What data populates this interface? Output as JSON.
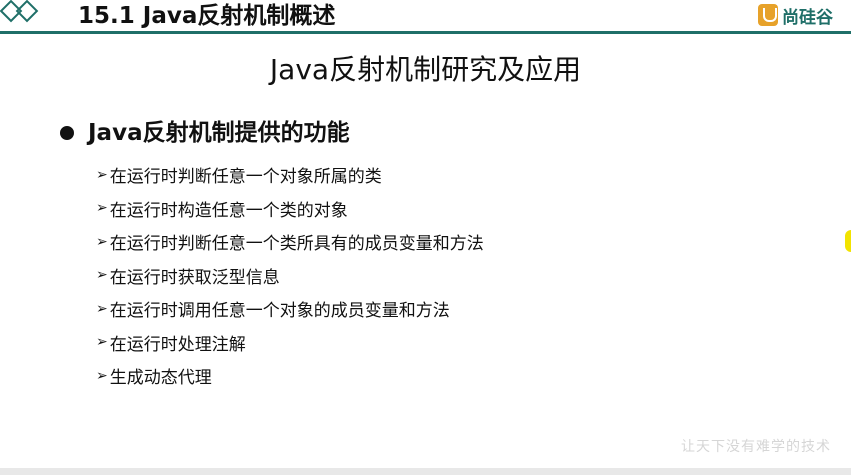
{
  "header": {
    "title": "15.1 Java反射机制概述",
    "logo_text": "尚硅谷",
    "accent_color": "#1f6f68"
  },
  "main": {
    "title": "Java反射机制研究及应用",
    "bullet_heading": "Java反射机制提供的功能",
    "items": [
      "在运行时判断任意一个对象所属的类",
      "在运行时构造任意一个类的对象",
      "在运行时判断任意一个类所具有的成员变量和方法",
      "在运行时获取泛型信息",
      "在运行时调用任意一个对象的成员变量和方法",
      "在运行时处理注解",
      "生成动态代理"
    ],
    "arrow_icon": "arrow-bullet-icon"
  },
  "watermark": "让天下没有难学的技术"
}
